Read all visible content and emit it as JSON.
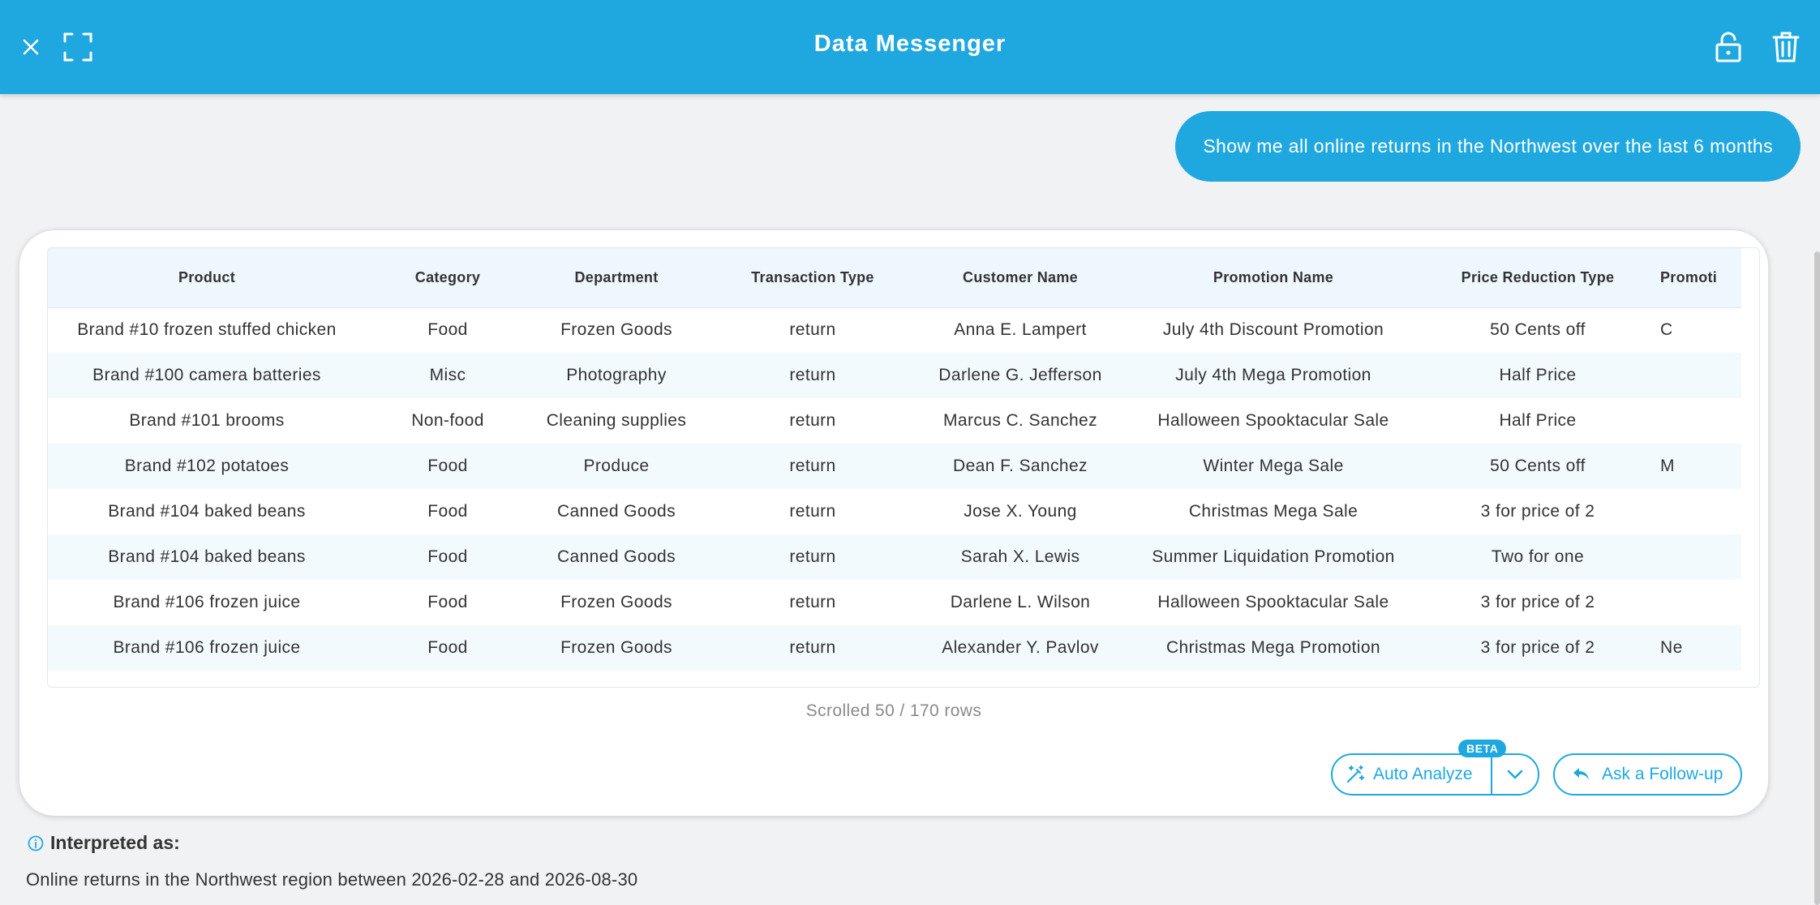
{
  "header": {
    "title": "Data Messenger"
  },
  "icons": {
    "close": "close-icon",
    "fullscreen": "fullscreen-icon",
    "lock": "lock-icon",
    "trash": "trash-icon"
  },
  "query": {
    "text": "Show me all online returns in the Northwest over the last 6 months"
  },
  "table": {
    "columns": [
      "Product",
      "Category",
      "Department",
      "Transaction Type",
      "Customer Name",
      "Promotion Name",
      "Price Reduction Type",
      "Promoti"
    ],
    "rows": [
      [
        "Brand #10 frozen stuffed chicken",
        "Food",
        "Frozen Goods",
        "return",
        "Anna E. Lampert",
        "July 4th Discount Promotion",
        "50 Cents off",
        "C"
      ],
      [
        "Brand #100 camera batteries",
        "Misc",
        "Photography",
        "return",
        "Darlene G. Jefferson",
        "July 4th Mega Promotion",
        "Half Price",
        ""
      ],
      [
        "Brand #101 brooms",
        "Non-food",
        "Cleaning supplies",
        "return",
        "Marcus C. Sanchez",
        "Halloween Spooktacular Sale",
        "Half Price",
        ""
      ],
      [
        "Brand #102 potatoes",
        "Food",
        "Produce",
        "return",
        "Dean F. Sanchez",
        "Winter Mega Sale",
        "50 Cents off",
        "M"
      ],
      [
        "Brand #104 baked beans",
        "Food",
        "Canned Goods",
        "return",
        "Jose X. Young",
        "Christmas Mega Sale",
        "3 for price of 2",
        ""
      ],
      [
        "Brand #104 baked beans",
        "Food",
        "Canned Goods",
        "return",
        "Sarah X. Lewis",
        "Summer Liquidation Promotion",
        "Two for one",
        ""
      ],
      [
        "Brand #106 frozen juice",
        "Food",
        "Frozen Goods",
        "return",
        "Darlene L. Wilson",
        "Halloween Spooktacular Sale",
        "3 for price of 2",
        ""
      ],
      [
        "Brand #106 frozen juice",
        "Food",
        "Frozen Goods",
        "return",
        "Alexander Y. Pavlov",
        "Christmas Mega Promotion",
        "3 for price of 2",
        "Ne"
      ]
    ]
  },
  "status": {
    "scrolled": "Scrolled 50 / 170 rows"
  },
  "actions": {
    "auto_analyze": "Auto Analyze",
    "beta_badge": "BETA",
    "follow_up": "Ask a Follow-up"
  },
  "interpretation": {
    "title": "Interpreted as:",
    "text": "Online returns in the Northwest region between 2026-02-28 and 2026-08-30"
  },
  "colors": {
    "accent": "#1fa8e0",
    "background": "#f1f2f4",
    "row_alt": "#f3fafe"
  }
}
